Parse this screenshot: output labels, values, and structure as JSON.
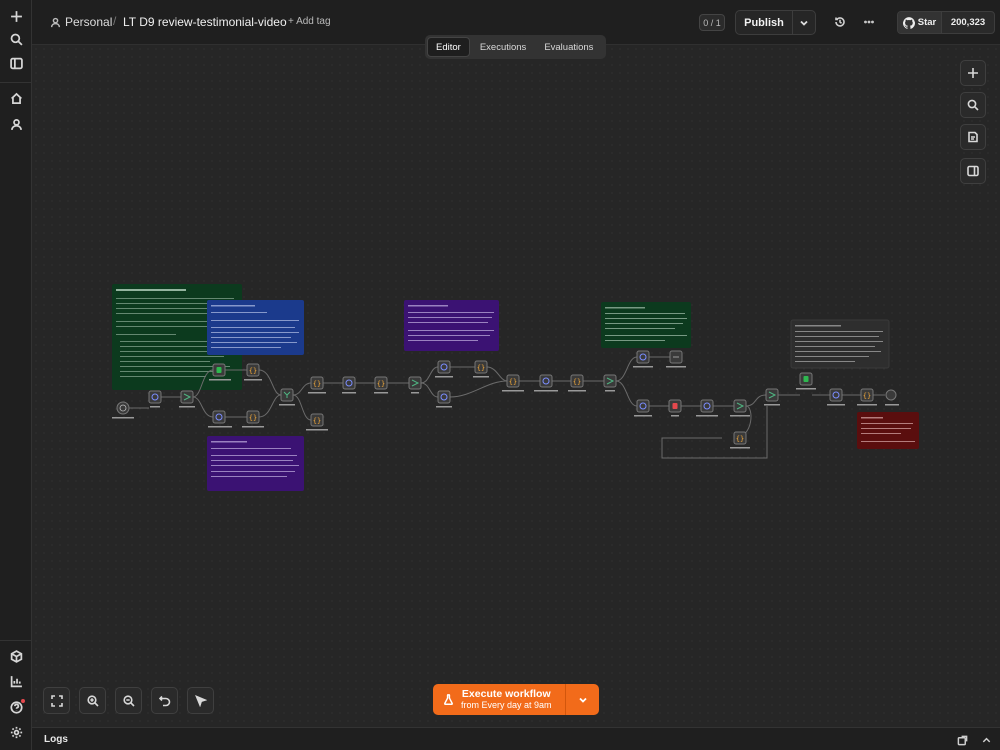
{
  "rail": {
    "icons": [
      "plus-icon",
      "search-icon",
      "sidebar-icon",
      "home-icon",
      "user-icon",
      "templates-icon",
      "insights-icon",
      "help-icon",
      "settings-icon"
    ]
  },
  "header": {
    "project": "Personal",
    "separator": "/",
    "workflow_title": "LT D9 review-testimonial-video",
    "add_tag": "+ Add tag",
    "version_counter": "0 / 1",
    "publish_label": "Publish",
    "github_star": "Star",
    "github_count": "200,323"
  },
  "tabs": [
    {
      "label": "Editor",
      "active": true
    },
    {
      "label": "Executions",
      "active": false
    },
    {
      "label": "Evaluations",
      "active": false
    }
  ],
  "execute": {
    "label": "Execute workflow",
    "sublabel": "from Every day at 9am",
    "color": "#f26b1a"
  },
  "logs": {
    "label": "Logs"
  },
  "colors": {
    "sticky_green": "#0c3a1e",
    "sticky_blue": "#1b3a8c",
    "sticky_purple": "#3b1273",
    "sticky_gray": "#2e2e2e",
    "sticky_red": "#5a0e0e"
  }
}
